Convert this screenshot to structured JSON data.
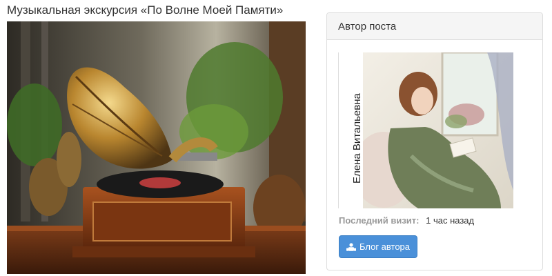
{
  "post": {
    "title": "Музыкальная экскурсия «По Волне Моей Памяти»",
    "image_subject": "gramophone-image"
  },
  "author_panel": {
    "heading": "Автор поста",
    "author_name": "Елена Витальевна",
    "photo_subject": "woman-reading-portrait",
    "last_visit_label": "Последний визит:",
    "last_visit_value": "1 час назад",
    "blog_button_label": "Блог автора",
    "blog_button_icon": "user-group-icon"
  },
  "colors": {
    "button_bg": "#4a90d9",
    "panel_heading_bg": "#f5f5f5",
    "border": "#dddddd"
  }
}
